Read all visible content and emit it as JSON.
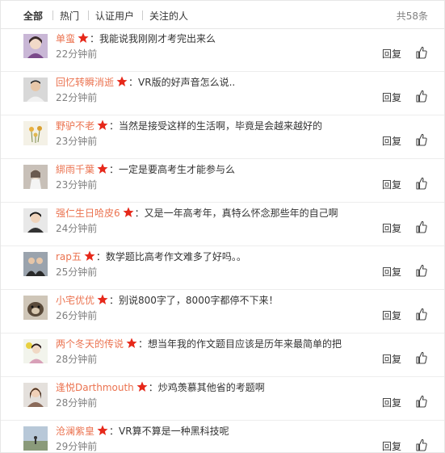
{
  "tabs": [
    {
      "label": "全部",
      "active": true
    },
    {
      "label": "热门",
      "active": false
    },
    {
      "label": "认证用户",
      "active": false
    },
    {
      "label": "关注的人",
      "active": false
    }
  ],
  "total_count": "共58条",
  "reply_label": "回复",
  "colors": {
    "username": "#eb7350",
    "badge": "#e6281a",
    "muted": "#808080"
  },
  "comments": [
    {
      "user": "单蛮",
      "text": "：我能说我刚刚才考完出来么",
      "time": "22分钟前",
      "avatar": "girl-avatar"
    },
    {
      "user": "回忆转瞬消逝",
      "text": "：VR版的好声音怎么说..",
      "time": "22分钟前",
      "avatar": "man-avatar"
    },
    {
      "user": "野驴不老",
      "text": "：当然是接受这样的生活啊，毕竟是会越来越好的",
      "time": "23分钟前",
      "avatar": "flowers-avatar"
    },
    {
      "user": "綁雨千葉",
      "text": "：一定是要高考生才能参与么",
      "time": "23分钟前",
      "avatar": "doll-avatar"
    },
    {
      "user": "强仁生日哈皮6",
      "text": "：又是一年高考年，真特么怀念那些年的自己啊",
      "time": "24分钟前",
      "avatar": "person-avatar"
    },
    {
      "user": "rap五",
      "text": "：数学题比高考作文难多了好吗。。",
      "time": "25分钟前",
      "avatar": "couple-avatar"
    },
    {
      "user": "小宅优优",
      "text": "：别说800字了，8000字都停不下来！",
      "time": "26分钟前",
      "avatar": "dog-avatar"
    },
    {
      "user": "两个冬天的传说",
      "text": "：想当年我的作文题目应该是历年来最简单的把",
      "time": "28分钟前",
      "avatar": "girl-flower-avatar"
    },
    {
      "user": "逢悦Darthmouth",
      "text": "：炒鸡羡慕其他省的考题啊",
      "time": "28分钟前",
      "avatar": "woman-avatar"
    },
    {
      "user": "沧澜紫皇",
      "text": "：VR算不算是一种黑科技呢",
      "time": "29分钟前",
      "avatar": "landscape-avatar"
    }
  ]
}
